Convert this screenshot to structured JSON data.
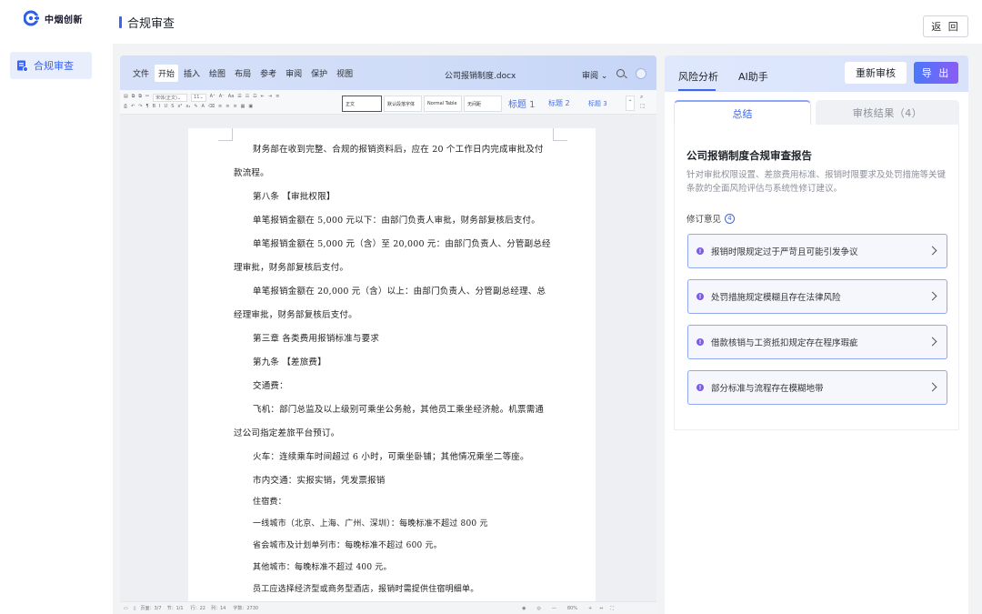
{
  "brand": {
    "name": "中烟创新"
  },
  "sidebar": {
    "items": [
      {
        "label": "合规审查"
      }
    ]
  },
  "header": {
    "title": "合规审查",
    "back_label": "返 回"
  },
  "editor": {
    "menus": [
      "文件",
      "开始",
      "插入",
      "绘图",
      "布局",
      "参考",
      "审阅",
      "保护",
      "视图"
    ],
    "active_menu": "开始",
    "filename": "公司报销制度.docx",
    "review_label": "审阅",
    "toolbar": {
      "font_name": "宋体(正文)",
      "font_size": "11",
      "styles": [
        "正文",
        "默认段落字体",
        "Normal Table",
        "无间距"
      ],
      "headings": [
        "标题 1",
        "标题 2",
        "标题 3"
      ]
    },
    "paragraphs": [
      "财务部在收到完整、合规的报销资料后，应在 20 个工作日内完成审批及付",
      "款流程。",
      "第八条 【审批权限】",
      "单笔报销金额在 5,000 元以下：由部门负责人审批，财务部复核后支付。",
      "单笔报销金额在 5,000 元（含）至 20,000 元：由部门负责人、分管副总经",
      "理审批，财务部复核后支付。",
      "单笔报销金额在 20,000 元（含）以上：由部门负责人、分管副总经理、总",
      "经理审批，财务部复核后支付。",
      "第三章 各类费用报销标准与要求",
      "第九条 【差旅费】",
      "交通费：",
      "飞机：部门总监及以上级别可乘坐公务舱，其他员工乘坐经济舱。机票需通",
      "过公司指定差旅平台预订。",
      "火车：连续乘车时间超过 6 小时，可乘坐卧铺；其他情况乘坐二等座。",
      "市内交通：实报实销，凭发票报销",
      "住宿费：",
      "一线城市（北京、上海、广州、深圳）：每晚标准不超过 800 元",
      "省会城市及计划单列市：每晚标准不超过 600 元。",
      "其他城市：每晚标准不超过 400 元。",
      "员工应选择经济型或商务型酒店，报销时需提供住宿明细单。"
    ],
    "status": {
      "page": "页面：3/7",
      "section": "节：1/1",
      "row": "行：22",
      "col": "列：14",
      "words": "字数：2730",
      "zoom": "80%"
    }
  },
  "panel": {
    "tabs": [
      "风险分析",
      "AI助手"
    ],
    "redo_label": "重新审核",
    "export_label": "导 出",
    "subtabs": {
      "summary": "总结",
      "results": "审核结果（4）"
    },
    "report_title": "公司报销制度合规审查报告",
    "report_desc": "针对审批权限设置、差旅费用标准、报销时限要求及处罚措施等关键条款的全面风险评估与系统性修订建议。",
    "revision_label": "修订意见",
    "revision_count": "4",
    "revisions": [
      {
        "text": "报销时限规定过于严苛且可能引发争议"
      },
      {
        "text": "处罚措施规定模糊且存在法律风险"
      },
      {
        "text": "借款核销与工资抵扣规定存在程序瑕疵"
      },
      {
        "text": "部分标准与流程存在模糊地带"
      }
    ]
  }
}
